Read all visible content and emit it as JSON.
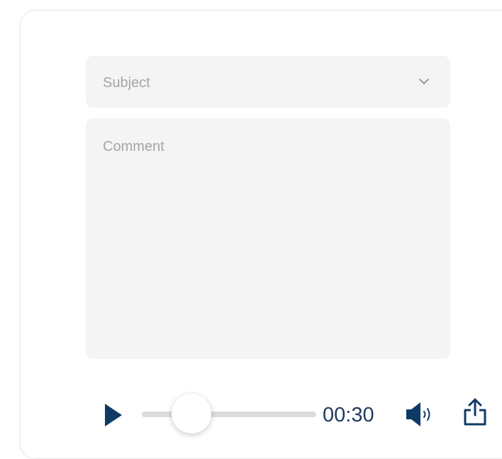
{
  "form": {
    "subject_placeholder": "Subject",
    "comment_placeholder": "Comment"
  },
  "player": {
    "time": "00:30",
    "progress": 0.28,
    "icons": {
      "play": "play-icon",
      "volume": "volume-icon",
      "share": "share-icon",
      "dropdown": "chevron-down-icon"
    }
  },
  "colors": {
    "accent": "#0f3a66",
    "field_bg": "#f4f4f4",
    "placeholder": "#a5a5a5",
    "track": "#dcdcdc"
  }
}
